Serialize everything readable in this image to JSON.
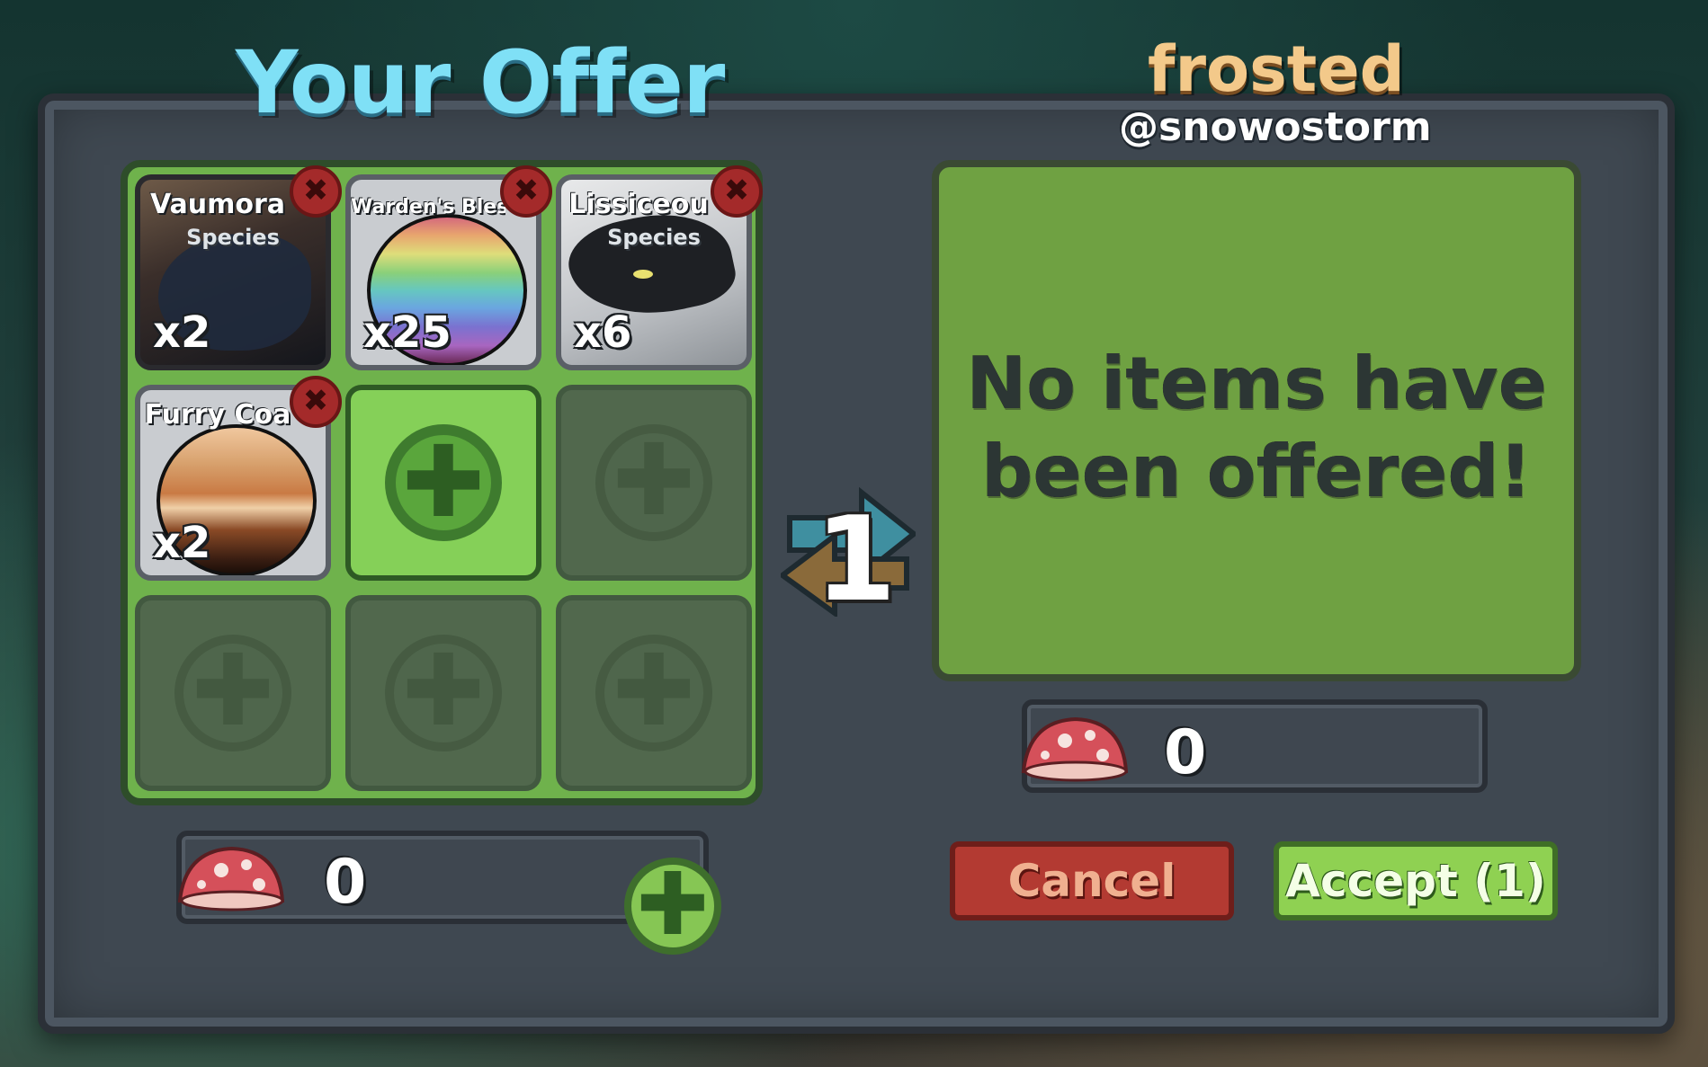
{
  "your_offer": {
    "title": "Your Offer",
    "items": [
      {
        "name": "Vaumora",
        "type": "Species",
        "qty": "x2"
      },
      {
        "name": "Warden's Bless",
        "type": "",
        "qty": "x25"
      },
      {
        "name": "Lissiceou",
        "type": "Species",
        "qty": "x6"
      },
      {
        "name": "Furry Coa",
        "type": "",
        "qty": "x2"
      }
    ],
    "remove_glyph": "✖",
    "add_glyph": "✚",
    "coins": "0"
  },
  "partner": {
    "display_name": "frosted",
    "username": "@snowostorm",
    "empty_message_line1": "No items have",
    "empty_message_line2": "been offered!",
    "coins": "0"
  },
  "swap_count": "1",
  "buttons": {
    "cancel": "Cancel",
    "accept": "Accept (1)"
  },
  "icons": {
    "currency": "mushroom-icon",
    "swap": "swap-arrows-icon"
  },
  "colors": {
    "your_offer_title": "#7fe0f6",
    "partner_name": "#f3c98a",
    "panel_green": "#6fb24c",
    "cancel_red": "#b33a32",
    "accept_green": "#8fd152"
  }
}
